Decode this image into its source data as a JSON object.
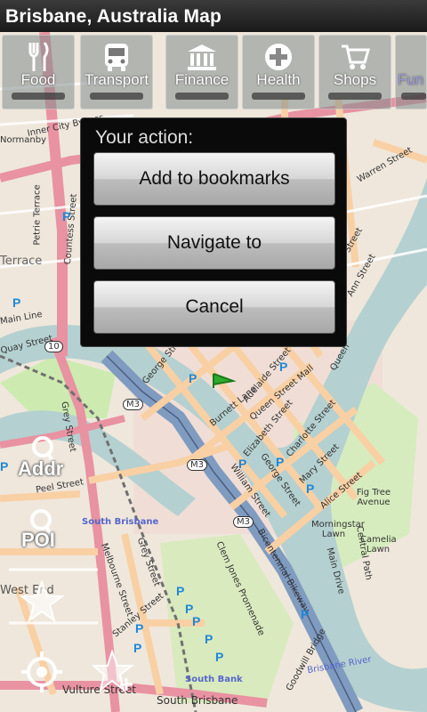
{
  "app": {
    "title": "Brisbane, Australia Map"
  },
  "categories": [
    {
      "label": "Food",
      "icon": "cutlery-icon"
    },
    {
      "label": "Transport",
      "icon": "bus-icon"
    },
    {
      "label": "Finance",
      "icon": "bank-icon"
    },
    {
      "label": "Health",
      "icon": "plus-cross-icon"
    },
    {
      "label": "Shops",
      "icon": "shopping-cart-icon"
    },
    {
      "label": "Fun & Ga",
      "icon": "fun-icon"
    }
  ],
  "dialog": {
    "title": "Your action:",
    "buttons": [
      "Add to bookmarks",
      "Navigate to",
      "Cancel"
    ]
  },
  "controls": {
    "addr": "Addr",
    "poi": "POI"
  },
  "map_labels": {
    "normanby": "Normanby",
    "inner_city_bypass": "Inner City Bypass",
    "petrie_terrace": "Petrie Terrace",
    "countess_street": "Countess Street",
    "terrace": "Terrace",
    "main_line": "Main Line",
    "quay_street": "Quay Street",
    "grey_street": "Grey Street",
    "george_street": "George Street",
    "adelaide_street": "Adelaide Street",
    "queen_street_mall": "Queen Street Mall",
    "burnett_lane": "Burnett Lane",
    "elizabeth_street": "Elizabeth Street",
    "charlotte_street": "Charlotte Street",
    "mary_street": "Mary Street",
    "william_street": "William Street",
    "george_street_2": "George Street",
    "alice_street": "Alice Street",
    "fig_tree_avenue": "Fig Tree Avenue",
    "morningstar_lawn": "Morningstar Lawn",
    "camelia_lawn": "Camelia Lawn",
    "central_path": "Central Path",
    "main_drive": "Main Drive",
    "south_brisbane": "South Brisbane",
    "peel_street": "Peel Street",
    "melbourne_street": "Melbourne Street",
    "grey_street_2": "Grey Street",
    "stanley_street": "Stanley Street",
    "clem_jones_promenade": "Clem Jones Promenade",
    "bicentennial_bikeway": "Bicentennial Bikeway",
    "goodwill_bridge": "Goodwill Bridge",
    "brisbane_river": "Brisbane River",
    "south_bank": "South Bank",
    "south_brisbane_2": "South Brisbane",
    "vulture_street": "Vulture Street",
    "west_end": "West End",
    "edward_street": "Edward Street",
    "queen": "Queen",
    "ann_street": "Ann Street",
    "warren_street": "Warren Street",
    "m3": "M3",
    "route10": "10"
  },
  "colors": {
    "titlebar": "#1f1f1f",
    "river": "#b5d0d0",
    "motorway": "#809bc0",
    "primary_road": "#e892a2",
    "secondary_road": "#f9d0a4",
    "park": "#cdebb0",
    "railway": "#707070"
  }
}
